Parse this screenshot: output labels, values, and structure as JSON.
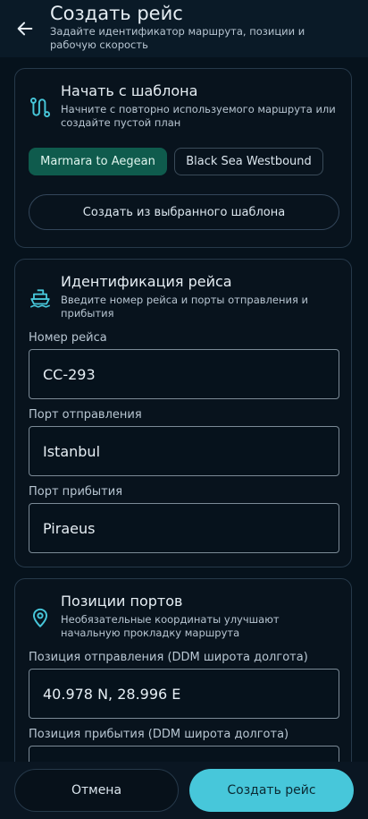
{
  "header": {
    "title": "Создать рейс",
    "subtitle": "Задайте идентификатор маршрута, позиции и рабочую скорость"
  },
  "template_card": {
    "title": "Начать с шаблона",
    "subtitle": "Начните с повторно используемого маршрута или создайте пустой план",
    "chips": [
      {
        "label": "Marmara to Aegean",
        "selected": true
      },
      {
        "label": "Black Sea Westbound",
        "selected": false
      }
    ],
    "create_button": "Создать из выбранного шаблона"
  },
  "voyage_card": {
    "title": "Идентификация рейса",
    "subtitle": "Введите номер рейса и порты отправления и прибытия",
    "fields": [
      {
        "label": "Номер рейса",
        "value": "CC-293"
      },
      {
        "label": "Порт отправления",
        "value": "Istanbul"
      },
      {
        "label": "Порт прибытия",
        "value": "Piraeus"
      }
    ]
  },
  "positions_card": {
    "title": "Позиции портов",
    "subtitle": "Необязательные координаты улучшают начальную прокладку маршрута",
    "fields": [
      {
        "label": "Позиция отправления (DDM широта долгота)",
        "value": "40.978 N, 28.996 E"
      },
      {
        "label": "Позиция прибытия (DDM широта долгота)",
        "value": ""
      }
    ]
  },
  "actions": {
    "cancel": "Отмена",
    "create": "Создать рейс"
  },
  "colors": {
    "background": "#06121c",
    "accent": "#47c7da",
    "selected_chip": "#0f5b4d"
  },
  "icons": [
    "back-arrow-icon",
    "route-icon",
    "ship-icon",
    "location-pin-icon"
  ]
}
